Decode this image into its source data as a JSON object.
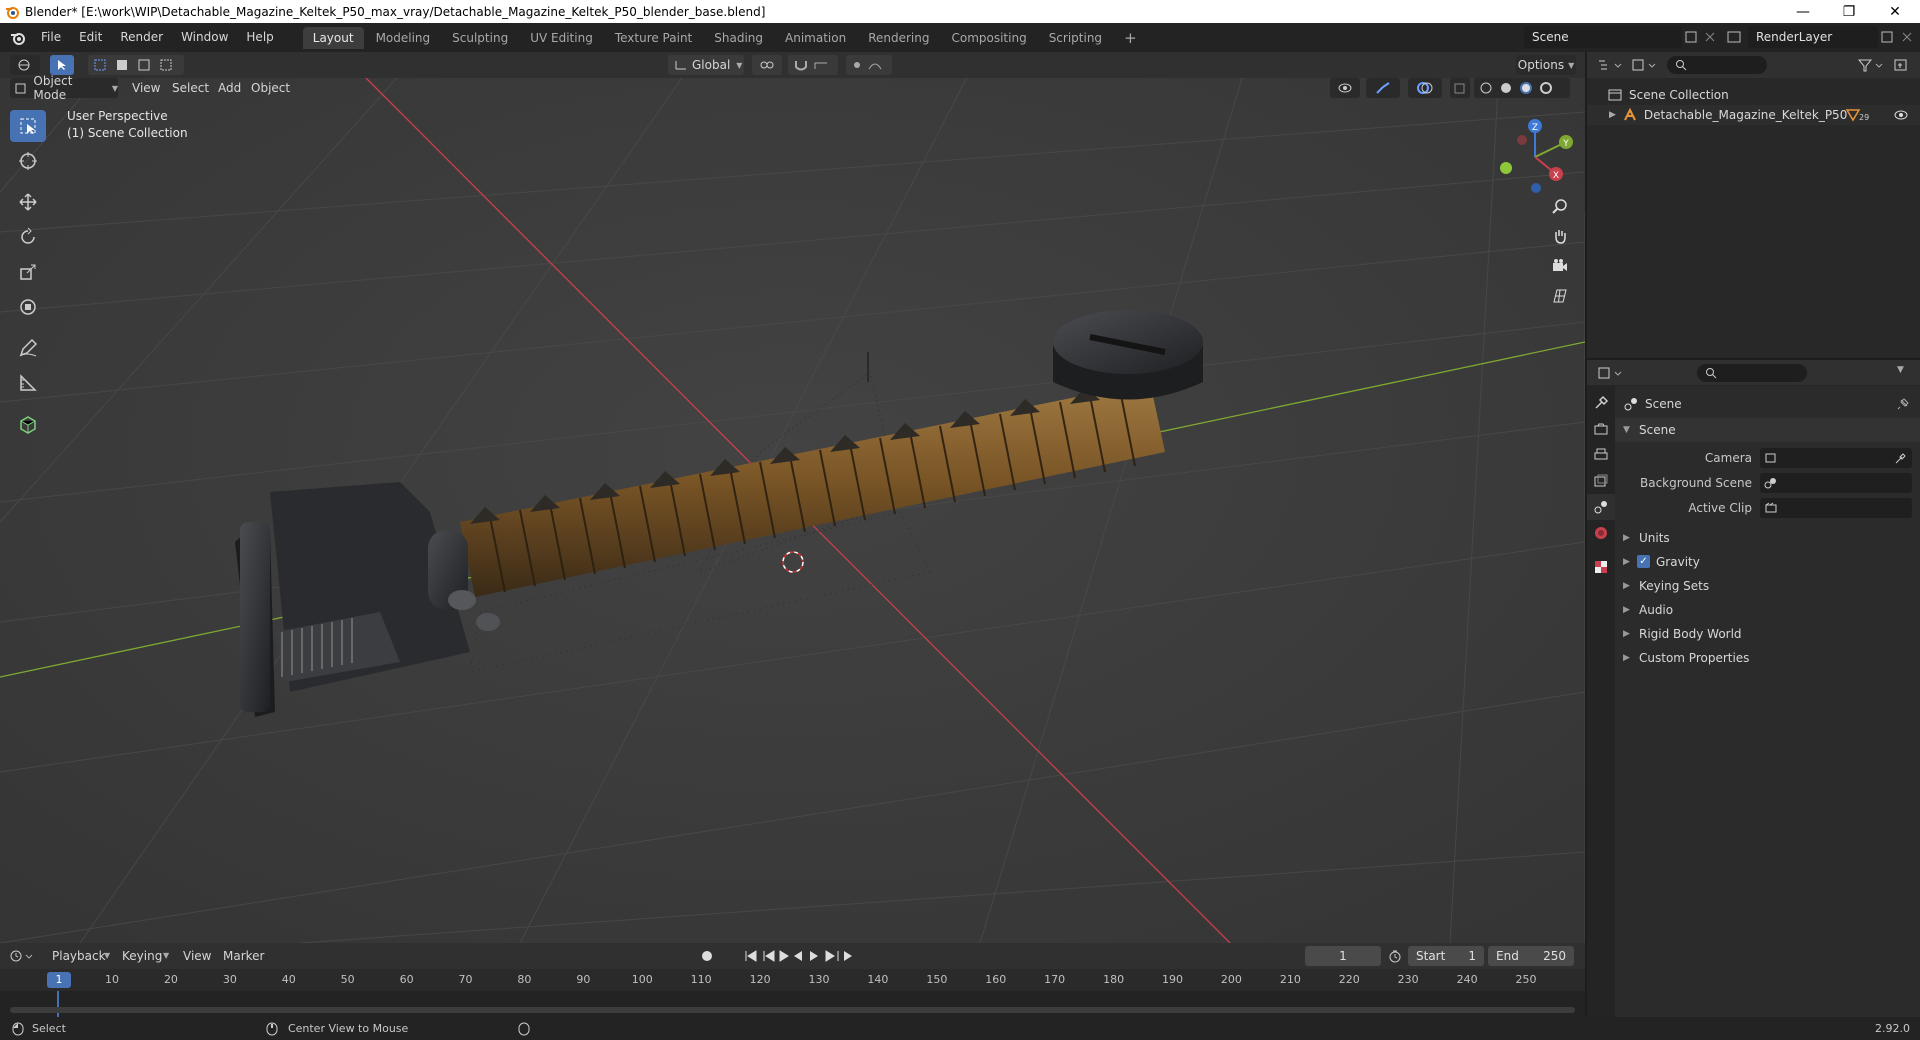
{
  "window": {
    "title": "Blender* [E:\\work\\WIP\\Detachable_Magazine_Keltek_P50_max_vray/Detachable_Magazine_Keltek_P50_blender_base.blend]",
    "minimize": "—",
    "restore": "❐",
    "close": "✕"
  },
  "menu": {
    "items": [
      "File",
      "Edit",
      "Render",
      "Window",
      "Help"
    ],
    "workspaces": [
      "Layout",
      "Modeling",
      "Sculpting",
      "UV Editing",
      "Texture Paint",
      "Shading",
      "Animation",
      "Rendering",
      "Compositing",
      "Scripting"
    ],
    "add_tab": "+",
    "scene": "Scene",
    "render_layer": "RenderLayer"
  },
  "viewport": {
    "transform_orientation": "Global",
    "options_label": "Options",
    "mode": "Object Mode",
    "menus": [
      "View",
      "Select",
      "Add",
      "Object"
    ],
    "info_line1": "User Perspective",
    "info_line2": "(1) Scene Collection",
    "gizmo": {
      "z": "Z",
      "y": "Y",
      "x": "X"
    },
    "colors": {
      "x_axis": "#c8404d",
      "y_axis": "#7fa832",
      "z_axis": "#3f7ad6",
      "active": "#4772b3"
    }
  },
  "outliner": {
    "collection": "Scene Collection",
    "object": "Detachable_Magazine_Keltek_P50",
    "object_badge": "29"
  },
  "properties": {
    "context": "Scene",
    "panel": "Scene",
    "camera_label": "Camera",
    "background_label": "Background Scene",
    "clip_label": "Active Clip",
    "subpanels": [
      "Units",
      "Gravity",
      "Keying Sets",
      "Audio",
      "Rigid Body World",
      "Custom Properties"
    ],
    "gravity_checked": true
  },
  "timeline": {
    "menus": [
      "Playback",
      "Keying",
      "View",
      "Marker"
    ],
    "current_frame": "1",
    "start_label": "Start",
    "start": "1",
    "end_label": "End",
    "end": "250",
    "ticks": [
      "1",
      "10",
      "20",
      "30",
      "40",
      "50",
      "60",
      "70",
      "80",
      "90",
      "100",
      "110",
      "120",
      "130",
      "140",
      "150",
      "160",
      "170",
      "180",
      "190",
      "200",
      "210",
      "220",
      "230",
      "240",
      "250"
    ]
  },
  "status": {
    "select": "Select",
    "center_view": "Center View to Mouse",
    "version": "2.92.0"
  }
}
